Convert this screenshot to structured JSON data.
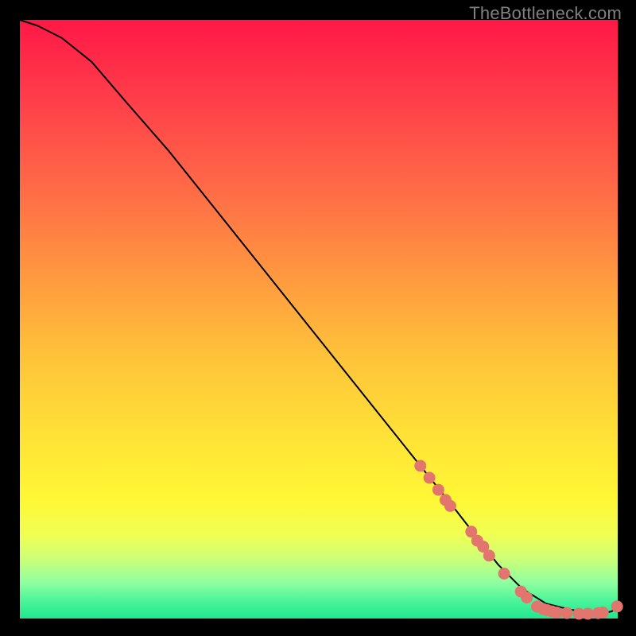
{
  "watermark": "TheBottleneck.com",
  "plot": {
    "bg_gradient_top": "#ff1846",
    "bg_gradient_bottom": "#20e68e",
    "curve_color": "#000000",
    "dot_color": "#e2756d"
  },
  "chart_data": {
    "type": "line",
    "title": "",
    "xlabel": "",
    "ylabel": "",
    "xlim": [
      0,
      100
    ],
    "ylim": [
      0,
      100
    ],
    "grid": false,
    "series": [
      {
        "name": "curve",
        "x": [
          0,
          3,
          7,
          12,
          18,
          25,
          33,
          41,
          49,
          57,
          65,
          73,
          80,
          84,
          88,
          92,
          95,
          97,
          99,
          100
        ],
        "y": [
          100,
          99,
          97,
          93,
          86,
          78,
          68,
          58,
          48,
          38,
          28,
          18,
          9,
          5,
          2.5,
          1.5,
          1,
          0.8,
          1.2,
          2
        ]
      }
    ],
    "points": [
      {
        "x": 67.0,
        "y": 25.5
      },
      {
        "x": 68.5,
        "y": 23.5
      },
      {
        "x": 70.0,
        "y": 21.5
      },
      {
        "x": 71.2,
        "y": 19.8
      },
      {
        "x": 72.0,
        "y": 18.8
      },
      {
        "x": 75.5,
        "y": 14.5
      },
      {
        "x": 76.5,
        "y": 13.0
      },
      {
        "x": 77.5,
        "y": 12.0
      },
      {
        "x": 78.5,
        "y": 10.5
      },
      {
        "x": 81.0,
        "y": 7.5
      },
      {
        "x": 83.8,
        "y": 4.5
      },
      {
        "x": 84.8,
        "y": 3.5
      },
      {
        "x": 86.5,
        "y": 2.0
      },
      {
        "x": 87.5,
        "y": 1.6
      },
      {
        "x": 88.2,
        "y": 1.4
      },
      {
        "x": 89.0,
        "y": 1.2
      },
      {
        "x": 89.8,
        "y": 1.0
      },
      {
        "x": 91.5,
        "y": 0.9
      },
      {
        "x": 93.5,
        "y": 0.8
      },
      {
        "x": 95.0,
        "y": 0.8
      },
      {
        "x": 96.7,
        "y": 0.9
      },
      {
        "x": 97.5,
        "y": 1.0
      },
      {
        "x": 99.9,
        "y": 2.0
      }
    ]
  }
}
